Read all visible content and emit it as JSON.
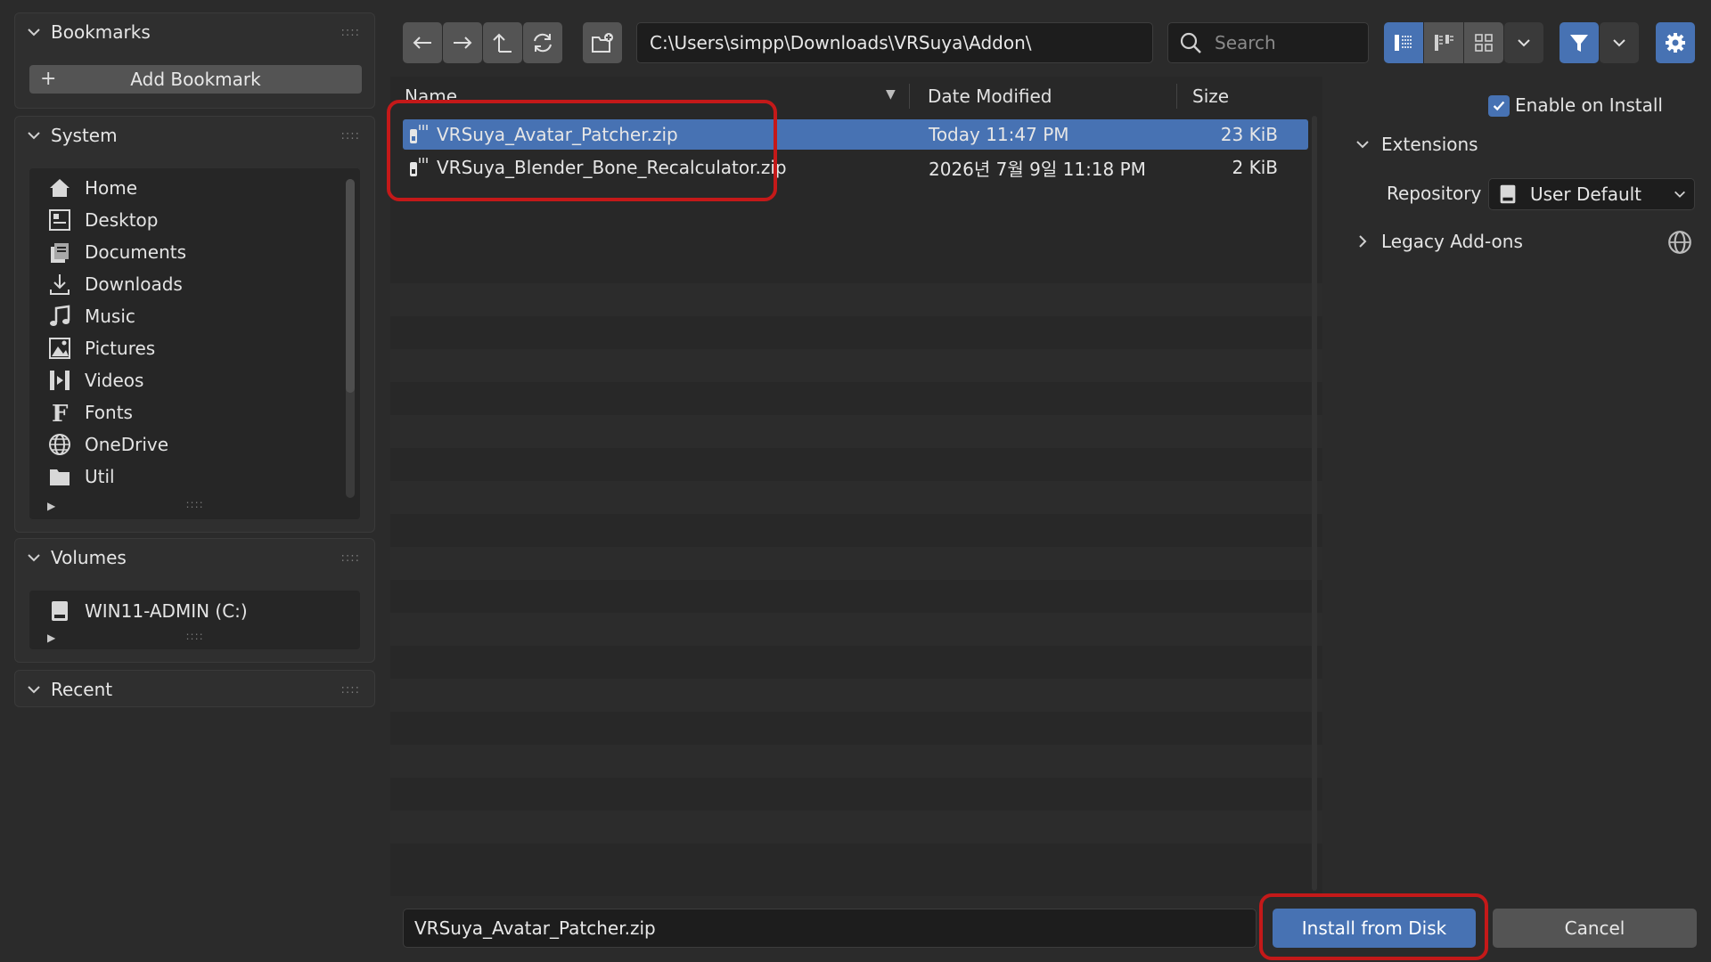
{
  "sidebar": {
    "bookmarks": {
      "title": "Bookmarks",
      "add_label": "Add Bookmark"
    },
    "system": {
      "title": "System",
      "items": [
        {
          "label": "Home",
          "icon": "home-icon"
        },
        {
          "label": "Desktop",
          "icon": "desktop-icon"
        },
        {
          "label": "Documents",
          "icon": "documents-icon"
        },
        {
          "label": "Downloads",
          "icon": "downloads-icon"
        },
        {
          "label": "Music",
          "icon": "music-icon"
        },
        {
          "label": "Pictures",
          "icon": "pictures-icon"
        },
        {
          "label": "Videos",
          "icon": "videos-icon"
        },
        {
          "label": "Fonts",
          "icon": "fonts-icon"
        },
        {
          "label": "OneDrive",
          "icon": "globe-icon"
        },
        {
          "label": "Util",
          "icon": "folder-icon"
        }
      ]
    },
    "volumes": {
      "title": "Volumes",
      "items": [
        {
          "label": "WIN11-ADMIN (C:)",
          "icon": "drive-icon"
        }
      ]
    },
    "recent": {
      "title": "Recent"
    }
  },
  "toolbar": {
    "path": "C:\\Users\\simpp\\Downloads\\VRSuya\\Addon\\",
    "search_placeholder": "Search"
  },
  "file_list": {
    "columns": {
      "name": "Name",
      "date": "Date Modified",
      "size": "Size"
    },
    "rows": [
      {
        "name": "VRSuya_Avatar_Patcher.zip",
        "date": "Today 11:47 PM",
        "size": "23 KiB",
        "selected": true
      },
      {
        "name": "VRSuya_Blender_Bone_Recalculator.zip",
        "date": "2026년 7월 9일 11:18 PM",
        "size": "2 KiB",
        "selected": false
      }
    ]
  },
  "options": {
    "enable_on_install": "Enable on Install",
    "enable_on_install_checked": true,
    "extensions_title": "Extensions",
    "repository_label": "Repository",
    "repository_value": "User Default",
    "legacy_title": "Legacy Add-ons"
  },
  "footer": {
    "filename": "VRSuya_Avatar_Patcher.zip",
    "install_label": "Install from Disk",
    "cancel_label": "Cancel"
  },
  "colors": {
    "accent": "#4772b3",
    "highlight": "#c41919",
    "background": "#2b2b2b"
  }
}
